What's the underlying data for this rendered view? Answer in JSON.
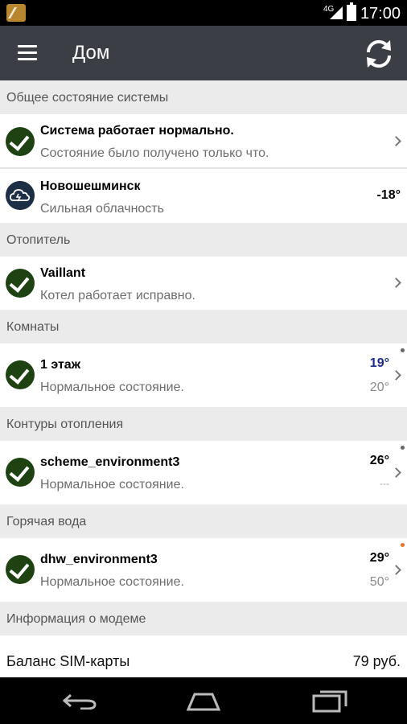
{
  "status_bar": {
    "network": "4G",
    "time": "17:00"
  },
  "app_bar": {
    "title": "Дом"
  },
  "sections": {
    "system": {
      "header": "Общее состояние системы",
      "status_primary": "Система работает нормально.",
      "status_secondary": "Состояние было получено только что.",
      "weather_city": "Новошешминск",
      "weather_desc": "Сильная облачность",
      "weather_temp": "-18°"
    },
    "heater": {
      "header": "Отопитель",
      "primary": "Vaillant",
      "secondary": "Котел работает исправно."
    },
    "rooms": {
      "header": "Комнаты",
      "primary": "1 этаж",
      "secondary": "Нормальное состояние.",
      "temp_current": "19°",
      "temp_target": "20°"
    },
    "circuits": {
      "header": "Контуры отопления",
      "primary": "scheme_environment3",
      "secondary": "Нормальное состояние.",
      "temp_current": "26°",
      "temp_target": "---"
    },
    "hot_water": {
      "header": "Горячая вода",
      "primary": "dhw_environment3",
      "secondary": "Нормальное состояние.",
      "temp_current": "29°",
      "temp_target": "50°"
    },
    "modem": {
      "header": "Информация о модеме",
      "label": "Баланс SIM-карты",
      "value": "79 руб."
    }
  },
  "colors": {
    "app_bar": "#3b3f45",
    "check": "#1e4212",
    "room_temp": "#1a2a8c",
    "hot_water_dot": "#e8742b"
  }
}
